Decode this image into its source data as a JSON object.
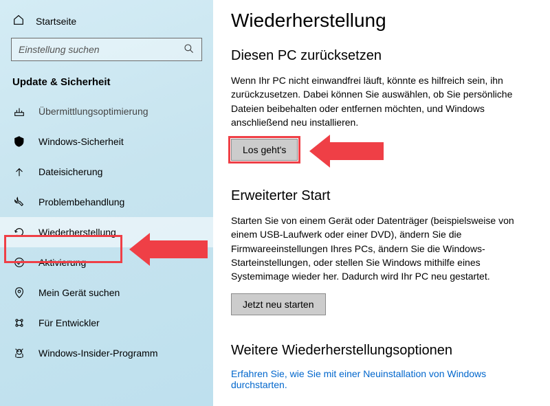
{
  "sidebar": {
    "home": "Startseite",
    "search_placeholder": "Einstellung suchen",
    "section": "Update & Sicherheit",
    "items": [
      {
        "label": "Übermittlungsoptimierung",
        "icon": "optimize-icon",
        "faded": true
      },
      {
        "label": "Windows-Sicherheit",
        "icon": "shield-icon"
      },
      {
        "label": "Dateisicherung",
        "icon": "backup-icon"
      },
      {
        "label": "Problembehandlung",
        "icon": "troubleshoot-icon"
      },
      {
        "label": "Wiederherstellung",
        "icon": "recovery-icon",
        "selected": true,
        "highlighted": true
      },
      {
        "label": "Aktivierung",
        "icon": "activation-icon"
      },
      {
        "label": "Mein Gerät suchen",
        "icon": "find-device-icon"
      },
      {
        "label": "Für Entwickler",
        "icon": "developer-icon"
      },
      {
        "label": "Windows-Insider-Programm",
        "icon": "insider-icon"
      }
    ]
  },
  "main": {
    "title": "Wiederherstellung",
    "reset": {
      "heading": "Diesen PC zurücksetzen",
      "body": "Wenn Ihr PC nicht einwandfrei läuft, könnte es hilfreich sein, ihn zurückzusetzen. Dabei können Sie auswählen, ob Sie persönliche Dateien beibehalten oder entfernen möchten, und Windows anschließend neu installieren.",
      "button": "Los geht's"
    },
    "advanced": {
      "heading": "Erweiterter Start",
      "body": "Starten Sie von einem Gerät oder Datenträger (beispielsweise von einem USB-Laufwerk oder einer DVD), ändern Sie die Firmwareeinstellungen Ihres PCs, ändern Sie die Windows-Starteinstellungen, oder stellen Sie Windows mithilfe eines Systemimage wieder her. Dadurch wird Ihr PC neu gestartet.",
      "button": "Jetzt neu starten"
    },
    "more": {
      "heading": "Weitere Wiederherstellungsoptionen",
      "link": "Erfahren Sie, wie Sie mit einer Neuinstallation von Windows durchstarten."
    }
  },
  "colors": {
    "accent_red": "#ef3f46",
    "link_blue": "#0066cc"
  }
}
